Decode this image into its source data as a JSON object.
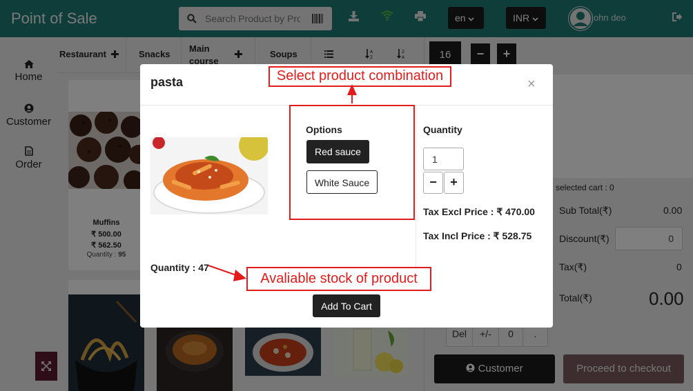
{
  "header": {
    "brand": "Point of Sale",
    "search_placeholder": "Search Product by Product name / barcode",
    "icons": [
      "search-icon",
      "barcode-icon",
      "download-icon",
      "wifi-icon",
      "printer-icon",
      "sign-out-icon"
    ],
    "language": "en",
    "currency": "INR",
    "user_name": "john deo",
    "colors": {
      "bar": "#1e7b74",
      "wifi": "#5bbf3a"
    }
  },
  "sidebar": {
    "items": [
      {
        "label": "Home",
        "icon": "home-icon"
      },
      {
        "label": "Customer",
        "icon": "user-circle-icon"
      },
      {
        "label": "Order",
        "icon": "document-icon"
      }
    ]
  },
  "categories": {
    "items": [
      {
        "label": "Restaurant"
      },
      {
        "label": "Snacks"
      },
      {
        "label": "Main course"
      },
      {
        "label": "Soups"
      }
    ]
  },
  "products": {
    "featured": {
      "name": "Muffins",
      "price_excl": "₹ 500.00",
      "price_incl": "₹ 562.50",
      "quantity_label": "Quantity :",
      "quantity_value": "95"
    }
  },
  "right_panel": {
    "quantity_value": "16",
    "minus": "−",
    "plus": "+",
    "selected_cart": "selected cart : 0",
    "sub_total_label": "Sub Total(₹)",
    "sub_total_value": "0.00",
    "discount_label": "Discount(₹)",
    "discount_value": "0",
    "tax_label": "Tax(₹)",
    "tax_value": "0",
    "total_label": "Total(₹)",
    "total_value": "0.00",
    "keypad": [
      "Del",
      "+/-",
      "0",
      "."
    ],
    "customer_button": "Customer",
    "checkout_button": "Proceed to checkout",
    "colors": {
      "checkout": "#7d5a5e"
    }
  },
  "modal": {
    "title": "pasta",
    "close": "×",
    "options_label": "Options",
    "options": [
      {
        "label": "Red sauce",
        "selected": true
      },
      {
        "label": "White Sauce",
        "selected": false
      }
    ],
    "quantity_label": "Quantity",
    "quantity_value": "1",
    "minus": "−",
    "plus": "+",
    "tax_excl": "Tax Excl Price : ₹ 470.00",
    "tax_incl": "Tax Incl Price : ₹ 528.75",
    "stock_label": "Quantity :",
    "stock_value": "47",
    "add_to_cart": "Add To Cart"
  },
  "annotations": {
    "combination": "Select product combination",
    "stock": "Avaliable stock of product",
    "color": "#e31b1b"
  }
}
